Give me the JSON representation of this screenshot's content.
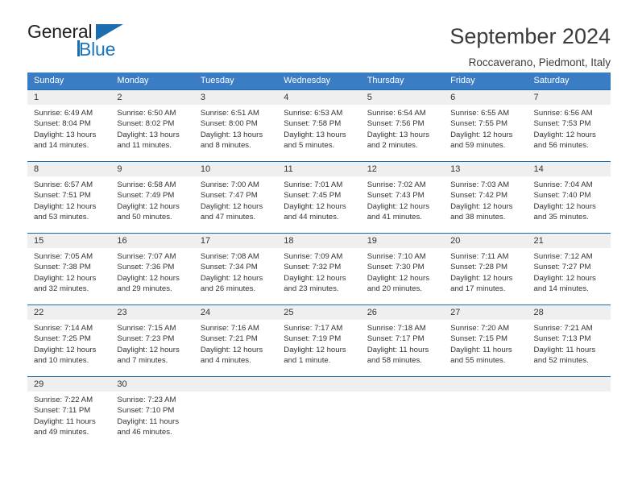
{
  "brand": {
    "name_part1": "General",
    "name_part2": "Blue",
    "triangle_color": "#1b6cb0",
    "blue_color": "#1b75bb"
  },
  "header": {
    "title": "September 2024",
    "subtitle": "Roccaverano, Piedmont, Italy"
  },
  "theme": {
    "header_bg": "#3b7dc4",
    "row_border": "#1b6cb0",
    "daynum_bg": "#efefef"
  },
  "weekdays": [
    "Sunday",
    "Monday",
    "Tuesday",
    "Wednesday",
    "Thursday",
    "Friday",
    "Saturday"
  ],
  "weeks": [
    [
      {
        "day": "1",
        "sunrise": "Sunrise: 6:49 AM",
        "sunset": "Sunset: 8:04 PM",
        "daylight1": "Daylight: 13 hours",
        "daylight2": "and 14 minutes."
      },
      {
        "day": "2",
        "sunrise": "Sunrise: 6:50 AM",
        "sunset": "Sunset: 8:02 PM",
        "daylight1": "Daylight: 13 hours",
        "daylight2": "and 11 minutes."
      },
      {
        "day": "3",
        "sunrise": "Sunrise: 6:51 AM",
        "sunset": "Sunset: 8:00 PM",
        "daylight1": "Daylight: 13 hours",
        "daylight2": "and 8 minutes."
      },
      {
        "day": "4",
        "sunrise": "Sunrise: 6:53 AM",
        "sunset": "Sunset: 7:58 PM",
        "daylight1": "Daylight: 13 hours",
        "daylight2": "and 5 minutes."
      },
      {
        "day": "5",
        "sunrise": "Sunrise: 6:54 AM",
        "sunset": "Sunset: 7:56 PM",
        "daylight1": "Daylight: 13 hours",
        "daylight2": "and 2 minutes."
      },
      {
        "day": "6",
        "sunrise": "Sunrise: 6:55 AM",
        "sunset": "Sunset: 7:55 PM",
        "daylight1": "Daylight: 12 hours",
        "daylight2": "and 59 minutes."
      },
      {
        "day": "7",
        "sunrise": "Sunrise: 6:56 AM",
        "sunset": "Sunset: 7:53 PM",
        "daylight1": "Daylight: 12 hours",
        "daylight2": "and 56 minutes."
      }
    ],
    [
      {
        "day": "8",
        "sunrise": "Sunrise: 6:57 AM",
        "sunset": "Sunset: 7:51 PM",
        "daylight1": "Daylight: 12 hours",
        "daylight2": "and 53 minutes."
      },
      {
        "day": "9",
        "sunrise": "Sunrise: 6:58 AM",
        "sunset": "Sunset: 7:49 PM",
        "daylight1": "Daylight: 12 hours",
        "daylight2": "and 50 minutes."
      },
      {
        "day": "10",
        "sunrise": "Sunrise: 7:00 AM",
        "sunset": "Sunset: 7:47 PM",
        "daylight1": "Daylight: 12 hours",
        "daylight2": "and 47 minutes."
      },
      {
        "day": "11",
        "sunrise": "Sunrise: 7:01 AM",
        "sunset": "Sunset: 7:45 PM",
        "daylight1": "Daylight: 12 hours",
        "daylight2": "and 44 minutes."
      },
      {
        "day": "12",
        "sunrise": "Sunrise: 7:02 AM",
        "sunset": "Sunset: 7:43 PM",
        "daylight1": "Daylight: 12 hours",
        "daylight2": "and 41 minutes."
      },
      {
        "day": "13",
        "sunrise": "Sunrise: 7:03 AM",
        "sunset": "Sunset: 7:42 PM",
        "daylight1": "Daylight: 12 hours",
        "daylight2": "and 38 minutes."
      },
      {
        "day": "14",
        "sunrise": "Sunrise: 7:04 AM",
        "sunset": "Sunset: 7:40 PM",
        "daylight1": "Daylight: 12 hours",
        "daylight2": "and 35 minutes."
      }
    ],
    [
      {
        "day": "15",
        "sunrise": "Sunrise: 7:05 AM",
        "sunset": "Sunset: 7:38 PM",
        "daylight1": "Daylight: 12 hours",
        "daylight2": "and 32 minutes."
      },
      {
        "day": "16",
        "sunrise": "Sunrise: 7:07 AM",
        "sunset": "Sunset: 7:36 PM",
        "daylight1": "Daylight: 12 hours",
        "daylight2": "and 29 minutes."
      },
      {
        "day": "17",
        "sunrise": "Sunrise: 7:08 AM",
        "sunset": "Sunset: 7:34 PM",
        "daylight1": "Daylight: 12 hours",
        "daylight2": "and 26 minutes."
      },
      {
        "day": "18",
        "sunrise": "Sunrise: 7:09 AM",
        "sunset": "Sunset: 7:32 PM",
        "daylight1": "Daylight: 12 hours",
        "daylight2": "and 23 minutes."
      },
      {
        "day": "19",
        "sunrise": "Sunrise: 7:10 AM",
        "sunset": "Sunset: 7:30 PM",
        "daylight1": "Daylight: 12 hours",
        "daylight2": "and 20 minutes."
      },
      {
        "day": "20",
        "sunrise": "Sunrise: 7:11 AM",
        "sunset": "Sunset: 7:28 PM",
        "daylight1": "Daylight: 12 hours",
        "daylight2": "and 17 minutes."
      },
      {
        "day": "21",
        "sunrise": "Sunrise: 7:12 AM",
        "sunset": "Sunset: 7:27 PM",
        "daylight1": "Daylight: 12 hours",
        "daylight2": "and 14 minutes."
      }
    ],
    [
      {
        "day": "22",
        "sunrise": "Sunrise: 7:14 AM",
        "sunset": "Sunset: 7:25 PM",
        "daylight1": "Daylight: 12 hours",
        "daylight2": "and 10 minutes."
      },
      {
        "day": "23",
        "sunrise": "Sunrise: 7:15 AM",
        "sunset": "Sunset: 7:23 PM",
        "daylight1": "Daylight: 12 hours",
        "daylight2": "and 7 minutes."
      },
      {
        "day": "24",
        "sunrise": "Sunrise: 7:16 AM",
        "sunset": "Sunset: 7:21 PM",
        "daylight1": "Daylight: 12 hours",
        "daylight2": "and 4 minutes."
      },
      {
        "day": "25",
        "sunrise": "Sunrise: 7:17 AM",
        "sunset": "Sunset: 7:19 PM",
        "daylight1": "Daylight: 12 hours",
        "daylight2": "and 1 minute."
      },
      {
        "day": "26",
        "sunrise": "Sunrise: 7:18 AM",
        "sunset": "Sunset: 7:17 PM",
        "daylight1": "Daylight: 11 hours",
        "daylight2": "and 58 minutes."
      },
      {
        "day": "27",
        "sunrise": "Sunrise: 7:20 AM",
        "sunset": "Sunset: 7:15 PM",
        "daylight1": "Daylight: 11 hours",
        "daylight2": "and 55 minutes."
      },
      {
        "day": "28",
        "sunrise": "Sunrise: 7:21 AM",
        "sunset": "Sunset: 7:13 PM",
        "daylight1": "Daylight: 11 hours",
        "daylight2": "and 52 minutes."
      }
    ],
    [
      {
        "day": "29",
        "sunrise": "Sunrise: 7:22 AM",
        "sunset": "Sunset: 7:11 PM",
        "daylight1": "Daylight: 11 hours",
        "daylight2": "and 49 minutes."
      },
      {
        "day": "30",
        "sunrise": "Sunrise: 7:23 AM",
        "sunset": "Sunset: 7:10 PM",
        "daylight1": "Daylight: 11 hours",
        "daylight2": "and 46 minutes."
      },
      {
        "day": "",
        "sunrise": "",
        "sunset": "",
        "daylight1": "",
        "daylight2": ""
      },
      {
        "day": "",
        "sunrise": "",
        "sunset": "",
        "daylight1": "",
        "daylight2": ""
      },
      {
        "day": "",
        "sunrise": "",
        "sunset": "",
        "daylight1": "",
        "daylight2": ""
      },
      {
        "day": "",
        "sunrise": "",
        "sunset": "",
        "daylight1": "",
        "daylight2": ""
      },
      {
        "day": "",
        "sunrise": "",
        "sunset": "",
        "daylight1": "",
        "daylight2": ""
      }
    ]
  ]
}
